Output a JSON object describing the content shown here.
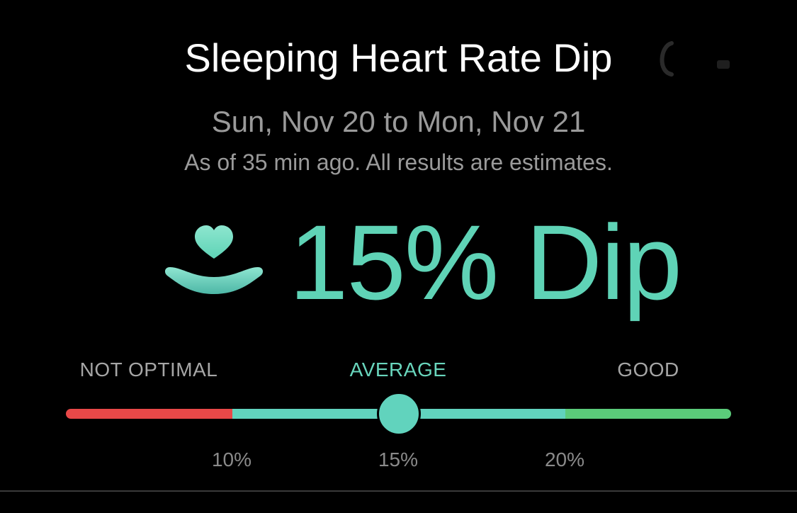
{
  "header": {
    "title": "Sleeping Heart Rate Dip"
  },
  "summary": {
    "date_range": "Sun, Nov 20 to Mon, Nov 21",
    "as_of": "As of 35 min ago. All results are estimates.",
    "dip_text": "15% Dip",
    "dip_value_percent": 15,
    "icon": "heart-dip-icon"
  },
  "scale": {
    "labels": {
      "not_optimal": "NOT OPTIMAL",
      "average": "AVERAGE",
      "good": "GOOD"
    },
    "active_category": "average",
    "ticks": [
      "10%",
      "15%",
      "20%"
    ],
    "min_percent": 5,
    "max_percent": 25,
    "current_percent": 15,
    "colors": {
      "not_optimal": "#e84848",
      "average": "#61d3bd",
      "good": "#5bcb7a"
    }
  },
  "colors": {
    "accent": "#5fd3b6",
    "background": "#000000"
  }
}
